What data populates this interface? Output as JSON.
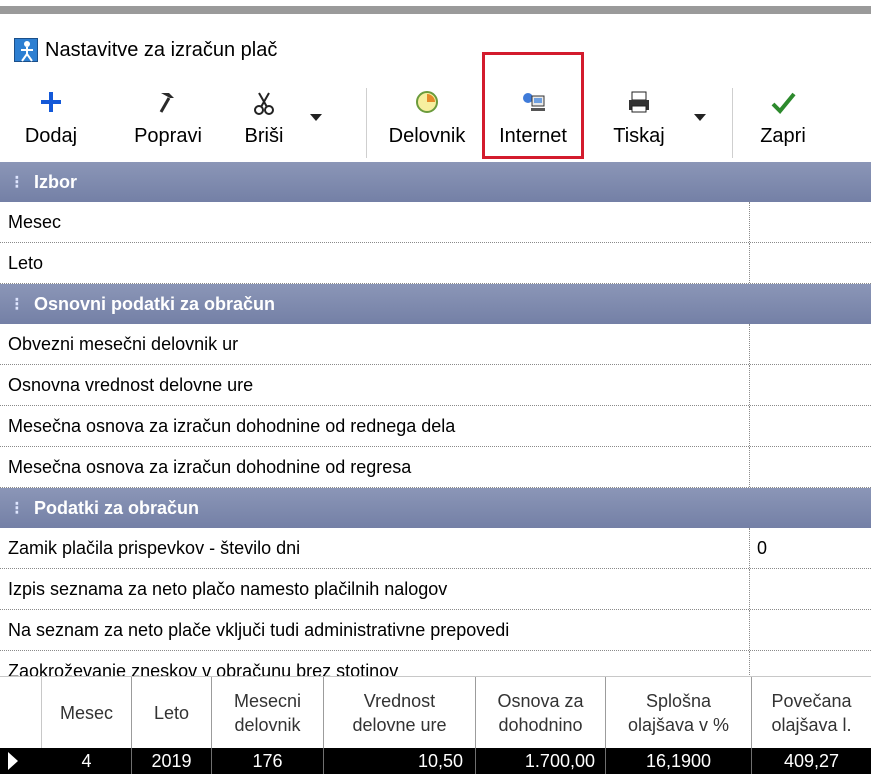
{
  "window": {
    "title": "Nastavitve za izračun plač"
  },
  "toolbar": {
    "buttons": [
      {
        "label": "Dodaj",
        "icon": "plus-icon"
      },
      {
        "label": "Popravi",
        "icon": "hammer-icon"
      },
      {
        "label": "Briši",
        "icon": "scissors-icon"
      },
      {
        "label": "Delovnik",
        "icon": "clock-icon"
      },
      {
        "label": "Internet",
        "icon": "network-computer-icon"
      },
      {
        "label": "Tiskaj",
        "icon": "printer-icon"
      },
      {
        "label": "Zapri",
        "icon": "check-icon"
      }
    ]
  },
  "sections": [
    {
      "title": "Izbor",
      "rows": [
        {
          "label": "Mesec",
          "value": ""
        },
        {
          "label": "Leto",
          "value": ""
        }
      ]
    },
    {
      "title": "Osnovni podatki za obračun",
      "rows": [
        {
          "label": "Obvezni mesečni delovnik ur",
          "value": ""
        },
        {
          "label": "Osnovna vrednost delovne ure",
          "value": ""
        },
        {
          "label": "Mesečna osnova za izračun dohodnine od rednega dela",
          "value": ""
        },
        {
          "label": "Mesečna osnova za izračun dohodnine od regresa",
          "value": ""
        }
      ]
    },
    {
      "title": "Podatki za obračun",
      "rows": [
        {
          "label": "Zamik plačila prispevkov - število dni",
          "value": "0"
        },
        {
          "label": "Izpis seznama za neto plačo namesto plačilnih nalogov",
          "value": ""
        },
        {
          "label": "Na seznam za neto plače vključi tudi administrativne prepovedi",
          "value": ""
        },
        {
          "label": "Zaokroževanje zneskov v obračunu brez stotinov",
          "value": ""
        }
      ]
    }
  ],
  "table": {
    "headers": [
      {
        "line1": "Mesec",
        "line2": ""
      },
      {
        "line1": "Leto",
        "line2": ""
      },
      {
        "line1": "Mesecni",
        "line2": "delovnik"
      },
      {
        "line1": "Vrednost",
        "line2": "delovne ure"
      },
      {
        "line1": "Osnova za",
        "line2": "dohodnino"
      },
      {
        "line1": "Splošna",
        "line2": "olajšava v %"
      },
      {
        "line1": "Povečana",
        "line2": "olajšava l."
      }
    ],
    "row": [
      "4",
      "2019",
      "176",
      "10,50",
      "1.700,00",
      "16,1900",
      "409,27"
    ]
  },
  "colors": {
    "section_header": "#7f8aae",
    "highlight_border": "#d31b2d",
    "selected_row": "#000000"
  }
}
